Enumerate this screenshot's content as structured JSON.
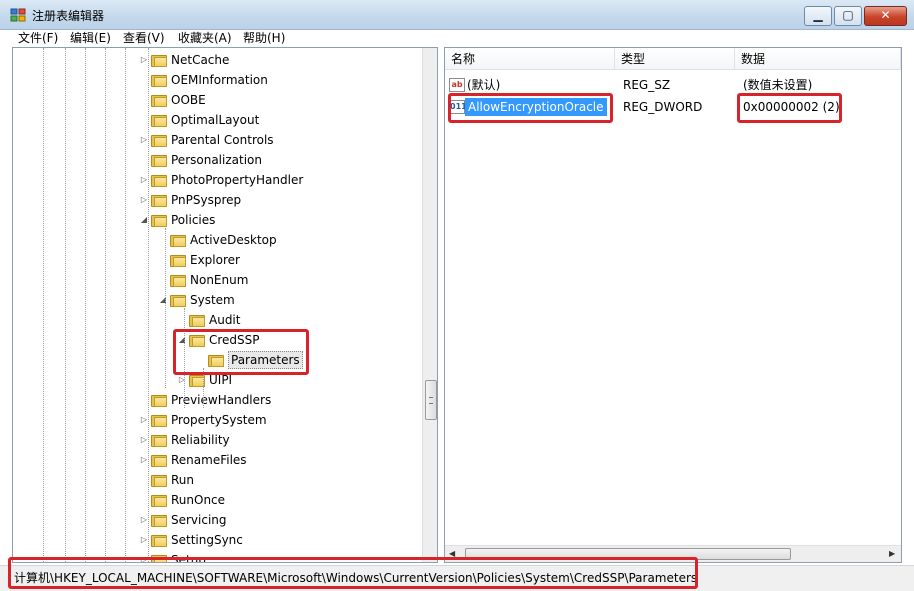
{
  "window": {
    "title": "注册表编辑器",
    "controls": [
      "minimize",
      "maximize",
      "close"
    ]
  },
  "menu": [
    {
      "label": "文件(F)"
    },
    {
      "label": "编辑(E)"
    },
    {
      "label": "查看(V)"
    },
    {
      "label": "收藏夹(A)"
    },
    {
      "label": "帮助(H)"
    }
  ],
  "tree": {
    "items": [
      {
        "label": "NetCache",
        "expander": "▷"
      },
      {
        "label": "OEMInformation",
        "expander": ""
      },
      {
        "label": "OOBE",
        "expander": ""
      },
      {
        "label": "OptimalLayout",
        "expander": ""
      },
      {
        "label": "Parental Controls",
        "expander": "▷"
      },
      {
        "label": "Personalization",
        "expander": ""
      },
      {
        "label": "PhotoPropertyHandler",
        "expander": "▷"
      },
      {
        "label": "PnPSysprep",
        "expander": "▷"
      },
      {
        "label": "Policies",
        "expander": "◢"
      },
      {
        "label": "ActiveDesktop",
        "expander": ""
      },
      {
        "label": "Explorer",
        "expander": ""
      },
      {
        "label": "NonEnum",
        "expander": ""
      },
      {
        "label": "System",
        "expander": "◢"
      },
      {
        "label": "Audit",
        "expander": ""
      },
      {
        "label": "CredSSP",
        "expander": "◢"
      },
      {
        "label": "Parameters",
        "expander": ""
      },
      {
        "label": "UIPI",
        "expander": "▷"
      },
      {
        "label": "PreviewHandlers",
        "expander": ""
      },
      {
        "label": "PropertySystem",
        "expander": "▷"
      },
      {
        "label": "Reliability",
        "expander": "▷"
      },
      {
        "label": "RenameFiles",
        "expander": "▷"
      },
      {
        "label": "Run",
        "expander": ""
      },
      {
        "label": "RunOnce",
        "expander": ""
      },
      {
        "label": "Servicing",
        "expander": "▷"
      },
      {
        "label": "SettingSync",
        "expander": "▷"
      },
      {
        "label": "Setup",
        "expander": "▷"
      }
    ]
  },
  "list": {
    "columns": [
      "名称",
      "类型",
      "数据"
    ],
    "rows": [
      {
        "name": "(默认)",
        "type": "REG_SZ",
        "data": "(数值未设置)",
        "icon": "string-value-icon"
      },
      {
        "name": "AllowEncryptionOracle",
        "type": "REG_DWORD",
        "data": "0x00000002 (2)",
        "icon": "dword-value-icon"
      }
    ]
  },
  "status": {
    "path": "计算机\\HKEY_LOCAL_MACHINE\\SOFTWARE\\Microsoft\\Windows\\CurrentVersion\\Policies\\System\\CredSSP\\Parameters"
  },
  "annotations": {
    "highlight_color": "#d9232b"
  }
}
